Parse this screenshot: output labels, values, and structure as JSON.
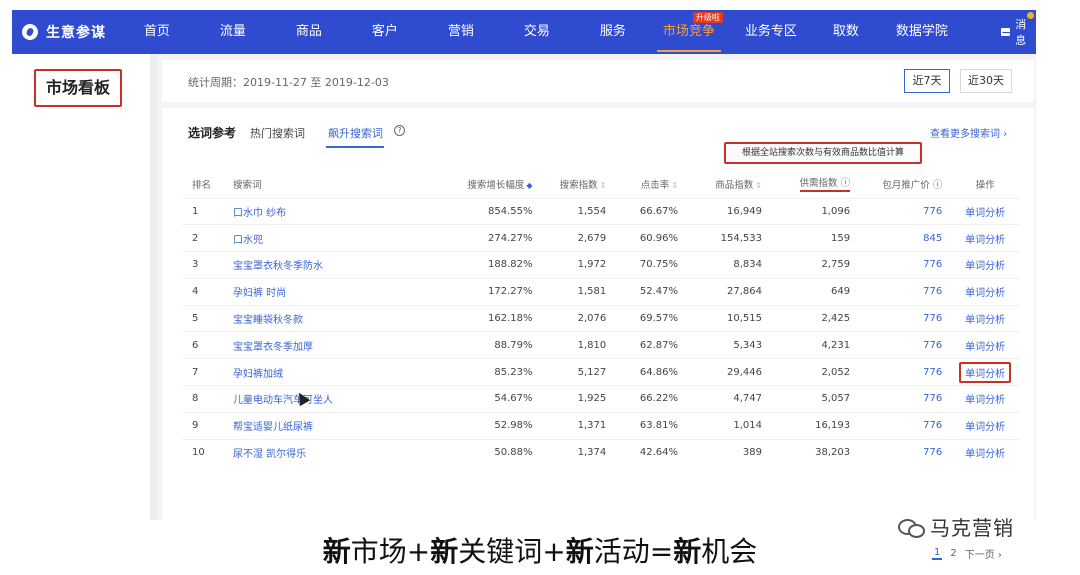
{
  "nav": {
    "brand": "生意参谋",
    "items": [
      "首页",
      "流量",
      "商品",
      "客户",
      "营销",
      "交易",
      "服务",
      "市场竞争",
      "业务专区",
      "取数",
      "数据学院"
    ],
    "active_index": 7,
    "badge": "升级啦",
    "message": "消息"
  },
  "sidebar": {
    "title": "市场看板"
  },
  "period": {
    "label": "统计周期：2019-11-27 至 2019-12-03",
    "btn_7": "近7天",
    "btn_30": "近30天"
  },
  "panel": {
    "title": "选词参考",
    "tab_hot": "热门搜索词",
    "tab_rise": "飙升搜索词",
    "more": "查看更多搜索词 ›",
    "tooltip": "根据全站搜索次数与有效商品数比值计算"
  },
  "table": {
    "headers": [
      "排名",
      "搜索词",
      "搜索增长幅度",
      "搜索指数",
      "点击率",
      "商品指数",
      "供需指数",
      "包月推广价",
      "操作"
    ],
    "rows": [
      {
        "rank": "1",
        "kw": "口水巾 纱布",
        "growth": "854.55%",
        "search": "1,554",
        "ctr": "66.67%",
        "goods": "16,949",
        "supply": "1,096",
        "price": "776",
        "op": "单词分析"
      },
      {
        "rank": "2",
        "kw": "口水兜",
        "growth": "274.27%",
        "search": "2,679",
        "ctr": "60.96%",
        "goods": "154,533",
        "supply": "159",
        "price": "845",
        "op": "单词分析"
      },
      {
        "rank": "3",
        "kw": "宝宝罩衣秋冬季防水",
        "growth": "188.82%",
        "search": "1,972",
        "ctr": "70.75%",
        "goods": "8,834",
        "supply": "2,759",
        "price": "776",
        "op": "单词分析"
      },
      {
        "rank": "4",
        "kw": "孕妇裤 时尚",
        "growth": "172.27%",
        "search": "1,581",
        "ctr": "52.47%",
        "goods": "27,864",
        "supply": "649",
        "price": "776",
        "op": "单词分析"
      },
      {
        "rank": "5",
        "kw": "宝宝睡袋秋冬款",
        "growth": "162.18%",
        "search": "2,076",
        "ctr": "69.57%",
        "goods": "10,515",
        "supply": "2,425",
        "price": "776",
        "op": "单词分析"
      },
      {
        "rank": "6",
        "kw": "宝宝罩衣冬季加厚",
        "growth": "88.79%",
        "search": "1,810",
        "ctr": "62.87%",
        "goods": "5,343",
        "supply": "4,231",
        "price": "776",
        "op": "单词分析"
      },
      {
        "rank": "7",
        "kw": "孕妇裤加绒",
        "growth": "85.23%",
        "search": "5,127",
        "ctr": "64.86%",
        "goods": "29,446",
        "supply": "2,052",
        "price": "776",
        "op": "单词分析"
      },
      {
        "rank": "8",
        "kw": "儿童电动车汽车可坐人",
        "growth": "54.67%",
        "search": "1,925",
        "ctr": "66.22%",
        "goods": "4,747",
        "supply": "5,057",
        "price": "776",
        "op": "单词分析"
      },
      {
        "rank": "9",
        "kw": "帮宝适婴儿纸尿裤",
        "growth": "52.98%",
        "search": "1,371",
        "ctr": "63.81%",
        "goods": "1,014",
        "supply": "16,193",
        "price": "776",
        "op": "单词分析"
      },
      {
        "rank": "10",
        "kw": "尿不湿 凯尔得乐",
        "growth": "50.88%",
        "search": "1,374",
        "ctr": "42.64%",
        "goods": "389",
        "supply": "38,203",
        "price": "776",
        "op": "单词分析"
      }
    ]
  },
  "pager": {
    "p1": "1",
    "p2": "2",
    "next": "下一页 ›"
  },
  "caption": {
    "p1": "新",
    "p2": "市场+",
    "p3": "新",
    "p4": "关键词+",
    "p5": "新",
    "p6": "活动=",
    "p7": "新",
    "p8": "机会"
  },
  "watermark": {
    "text": "马克营销"
  }
}
